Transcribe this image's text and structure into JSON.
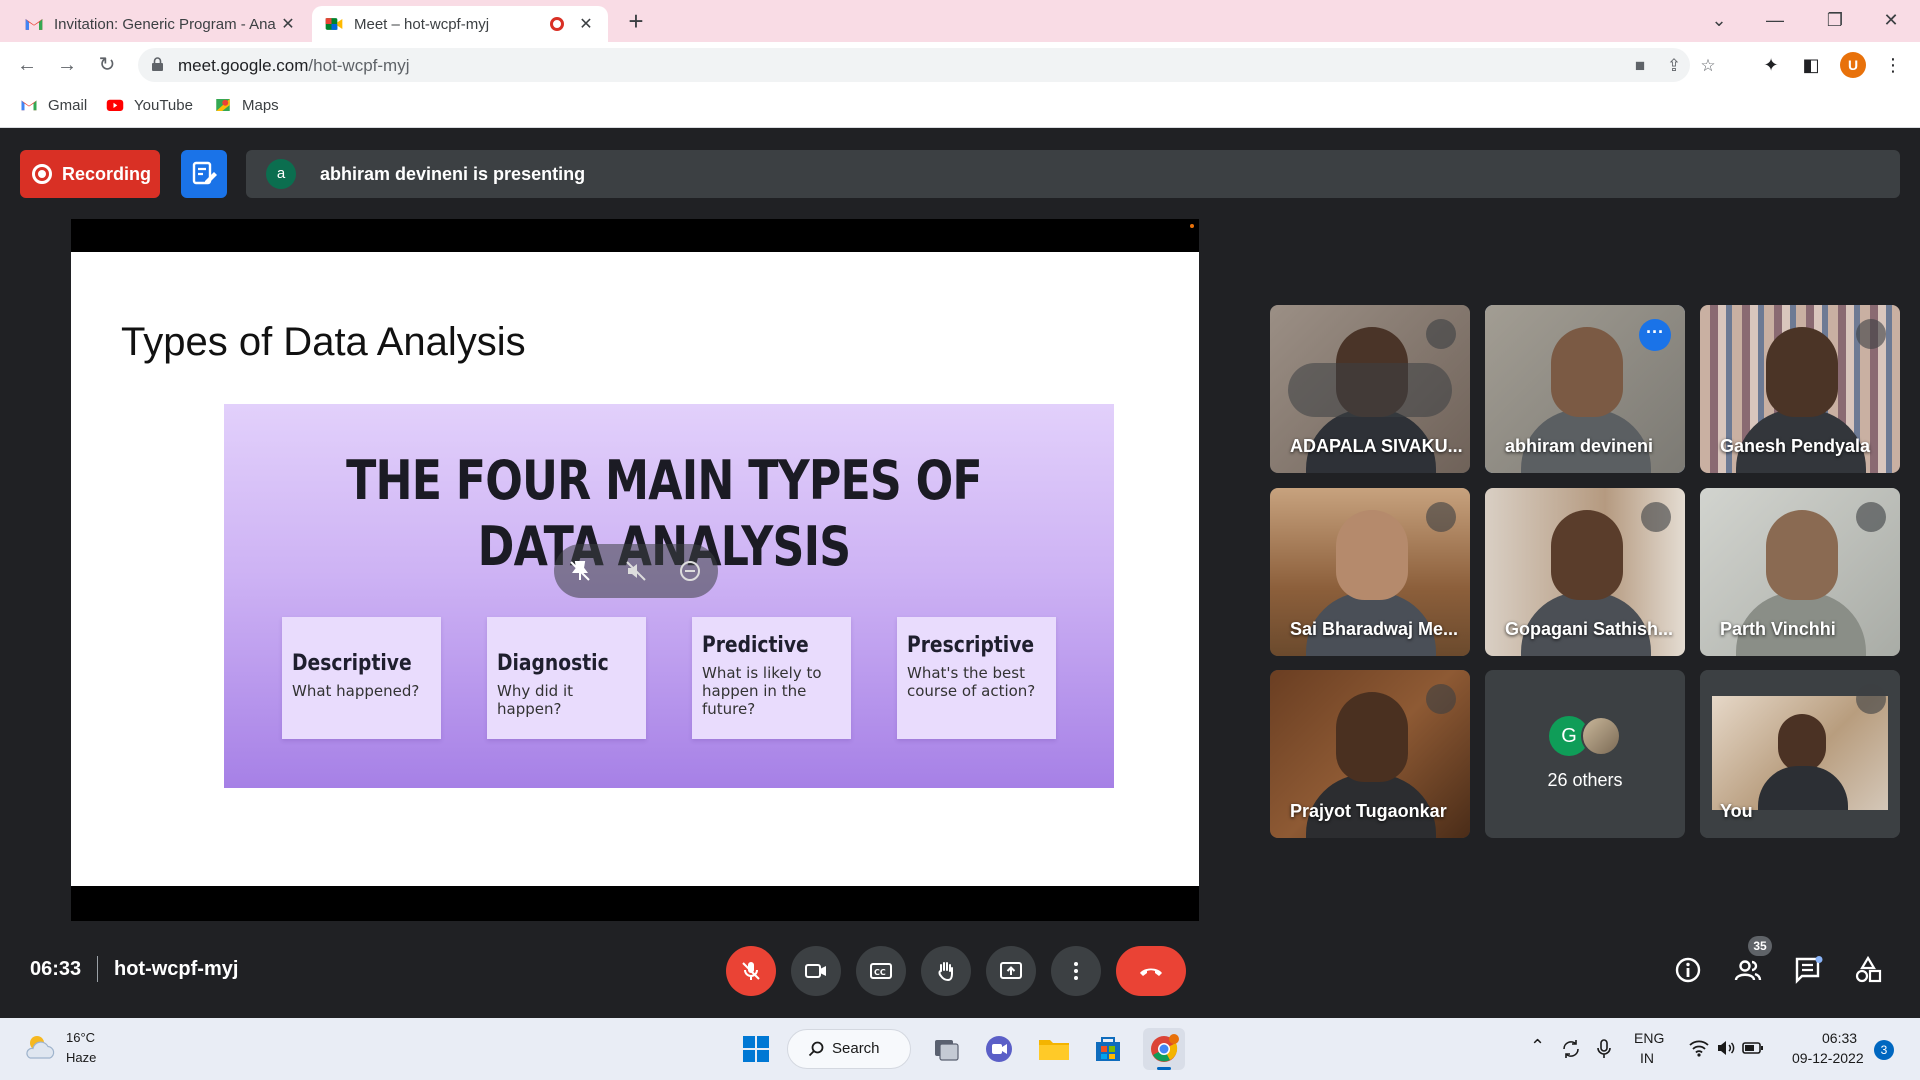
{
  "browser": {
    "tabs": [
      {
        "title": "Invitation: Generic Program - Ana",
        "favicon": "gmail-icon"
      },
      {
        "title": "Meet – hot-wcpf-myj",
        "favicon": "meet-icon",
        "recording_indicator": true
      }
    ],
    "url_host": "meet.google.com",
    "url_path": "/hot-wcpf-myj",
    "profile_initial": "U",
    "bookmarks": [
      {
        "label": "Gmail",
        "icon": "gmail-icon"
      },
      {
        "label": "YouTube",
        "icon": "youtube-icon"
      },
      {
        "label": "Maps",
        "icon": "maps-icon"
      }
    ]
  },
  "meet": {
    "recording_label": "Recording",
    "presenter_initial": "a",
    "presenting_text": "abhiram devineni is presenting",
    "slide": {
      "title": "Types of Data Analysis",
      "heading_line1": "THE FOUR MAIN TYPES OF",
      "heading_line2": "DATA ANALYSIS",
      "cards": [
        {
          "title": "Descriptive",
          "desc": "What happened?"
        },
        {
          "title": "Diagnostic",
          "desc": "Why did it happen?"
        },
        {
          "title": "Predictive",
          "desc": "What is likely to happen in the future?"
        },
        {
          "title": "Prescriptive",
          "desc": "What's the best course of action?"
        }
      ]
    },
    "participants": [
      {
        "name": "ADAPALA SIVAKU...",
        "muted": true
      },
      {
        "name": "abhiram devineni",
        "muted": false,
        "active_speaker": true
      },
      {
        "name": "Ganesh Pendyala",
        "muted": true
      },
      {
        "name": "Sai Bharadwaj Me...",
        "muted": true
      },
      {
        "name": "Gopagani Sathish...",
        "muted": true
      },
      {
        "name": "Parth Vinchhi",
        "muted": true
      },
      {
        "name": "Prajyot Tugaonkar",
        "muted": true
      },
      {
        "name": "You",
        "muted": true
      }
    ],
    "others": {
      "initial": "G",
      "label": "26 others"
    },
    "time": "06:33",
    "meeting_code": "hot-wcpf-myj",
    "people_count": "35",
    "colors": {
      "end_call": "#ea4335",
      "accent": "#1a73e8",
      "background": "#202124"
    }
  },
  "taskbar": {
    "weather_temp": "16°C",
    "weather_cond": "Haze",
    "search_label": "Search",
    "lang_line1": "ENG",
    "lang_line2": "IN",
    "clock_time": "06:33",
    "clock_date": "09-12-2022",
    "notifications": "3"
  }
}
